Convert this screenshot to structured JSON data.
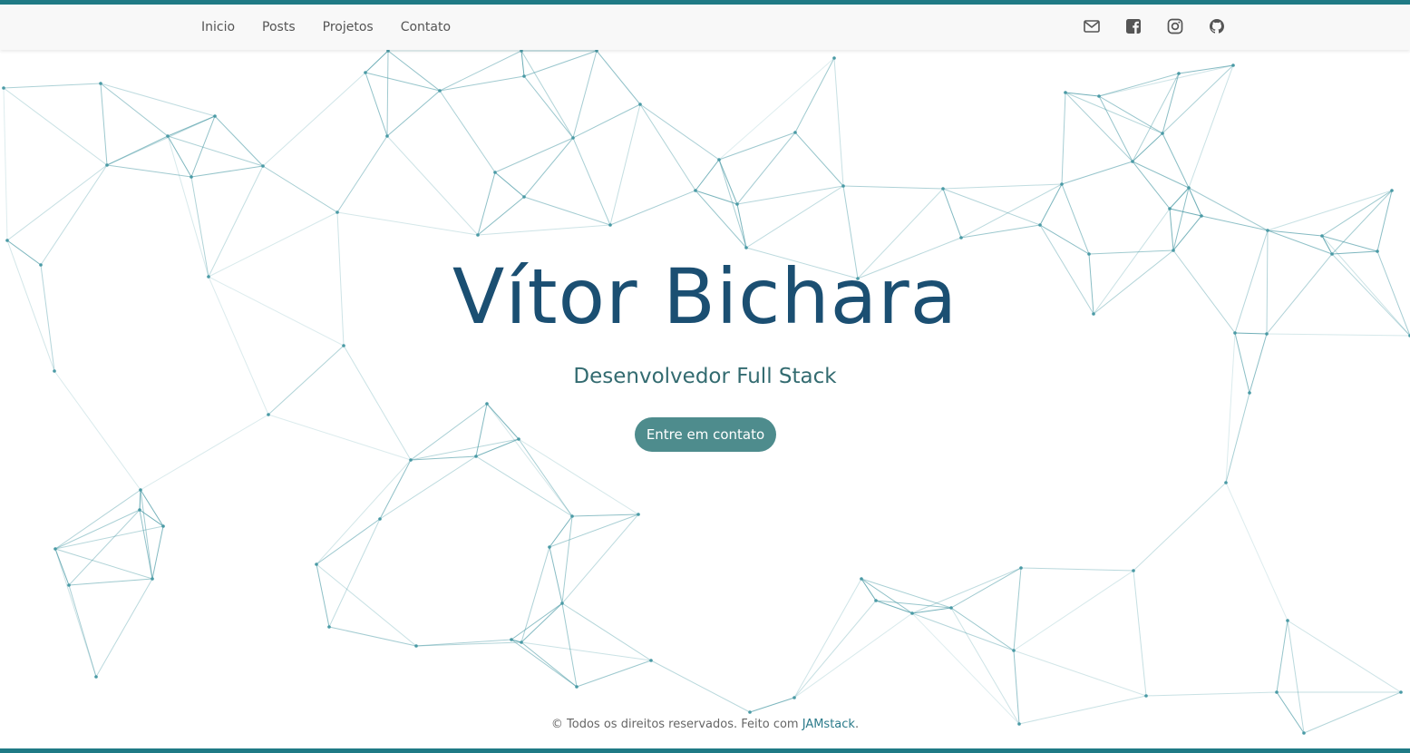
{
  "nav": {
    "links": [
      {
        "label": "Inicio"
      },
      {
        "label": "Posts"
      },
      {
        "label": "Projetos"
      },
      {
        "label": "Contato"
      }
    ],
    "icons": [
      "mail-icon",
      "facebook-icon",
      "instagram-icon",
      "github-icon"
    ]
  },
  "hero": {
    "title": "Vítor Bichara",
    "subtitle": "Desenvolvedor Full Stack",
    "button_label": "Entre em contato"
  },
  "footer": {
    "text": "© Todos os direitos reservados. Feito com ",
    "link_label": "JAMstack",
    "suffix": "."
  },
  "colors": {
    "accent": "#1f7a85",
    "title": "#1b4f72",
    "subtitle": "#336b70",
    "button": "#4e8c8d",
    "network": "#4a9aa5"
  }
}
